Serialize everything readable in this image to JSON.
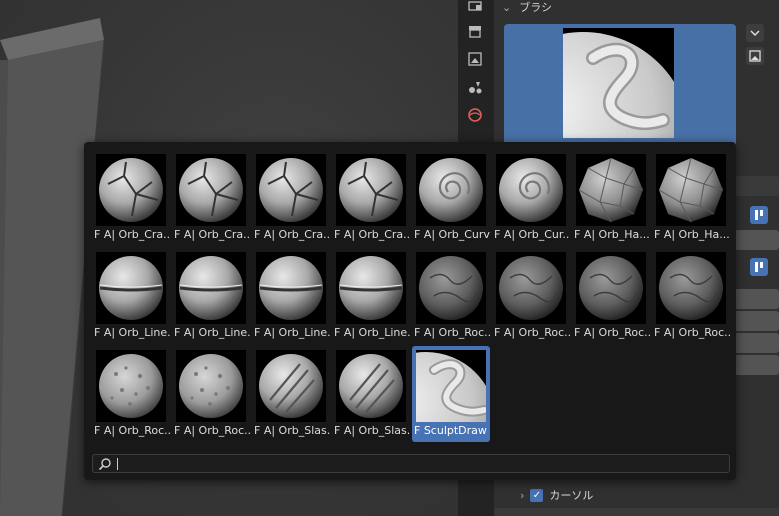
{
  "brush_panel": {
    "header": "ブラシ",
    "cursor_label": "カーソル"
  },
  "brush_tiles": [
    {
      "label": "F A| Orb_Cra...",
      "kind": "crack"
    },
    {
      "label": "F A| Orb_Cra...",
      "kind": "crack"
    },
    {
      "label": "F A| Orb_Cra...",
      "kind": "crack"
    },
    {
      "label": "F A| Orb_Cra...",
      "kind": "crack"
    },
    {
      "label": "F A| Orb_Curv",
      "kind": "curve"
    },
    {
      "label": "F A| Orb_Cur...",
      "kind": "curve"
    },
    {
      "label": "F A| Orb_Ha...",
      "kind": "hard"
    },
    {
      "label": "F A| Orb_Ha...",
      "kind": "hard"
    },
    {
      "label": "F A| Orb_Line...",
      "kind": "line"
    },
    {
      "label": "F A| Orb_Line...",
      "kind": "line"
    },
    {
      "label": "F A| Orb_Line...",
      "kind": "line"
    },
    {
      "label": "F A| Orb_Line...",
      "kind": "line"
    },
    {
      "label": "F A| Orb_Roc...",
      "kind": "rock"
    },
    {
      "label": "F A| Orb_Roc...",
      "kind": "rock"
    },
    {
      "label": "F A| Orb_Roc...",
      "kind": "rock"
    },
    {
      "label": "F A| Orb_Roc...",
      "kind": "rock"
    },
    {
      "label": "F A| Orb_Roc...",
      "kind": "rough"
    },
    {
      "label": "F A| Orb_Roc...",
      "kind": "rough"
    },
    {
      "label": "F A| Orb_Slas...",
      "kind": "slash"
    },
    {
      "label": "F A| Orb_Slas...",
      "kind": "slash"
    },
    {
      "label": "F SculptDraw",
      "kind": "draw",
      "active": true
    }
  ],
  "search": {
    "value": "",
    "placeholder": ""
  },
  "colors": {
    "accent": "#4772b3",
    "popup_bg": "#181818",
    "panel_bg": "#303030"
  }
}
